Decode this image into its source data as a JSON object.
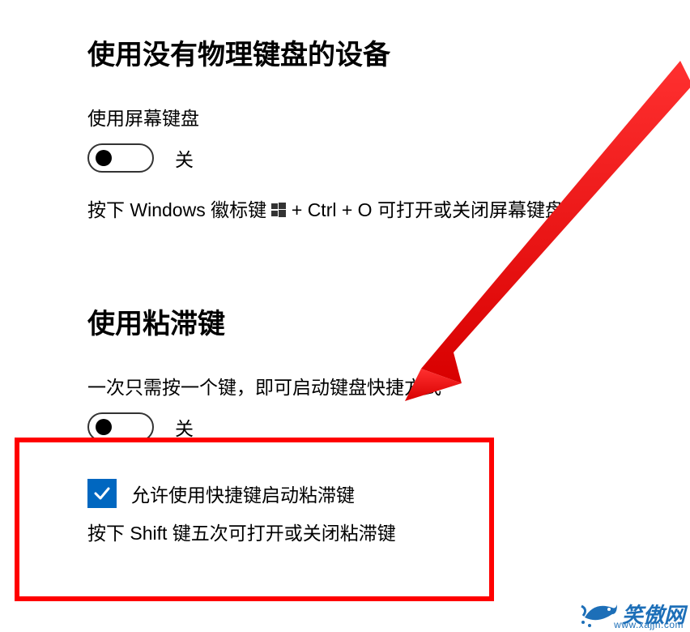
{
  "section1": {
    "heading": "使用没有物理键盘的设备",
    "screenKeyboard": {
      "label": "使用屏幕键盘",
      "toggleState": "关",
      "descPrefix": "按下 Windows 徽标键 ",
      "descSuffix": " + Ctrl + O 可打开或关闭屏幕键盘。",
      "winIcon": "windows-logo"
    }
  },
  "section2": {
    "heading": "使用粘滞键",
    "stickyKeys": {
      "label": "一次只需按一个键，即可启动键盘快捷方式",
      "toggleState": "关",
      "checkbox": {
        "checked": true,
        "label": "允许使用快捷键启动粘滞键"
      },
      "desc": "按下 Shift 键五次可打开或关闭粘滞键"
    }
  },
  "watermark": {
    "text": "笑傲网",
    "url": "www.xajjn.com"
  },
  "colors": {
    "accentBlue": "#0067c0",
    "highlightRed": "#ff0000",
    "watermarkBlue": "#1d6fb8"
  }
}
